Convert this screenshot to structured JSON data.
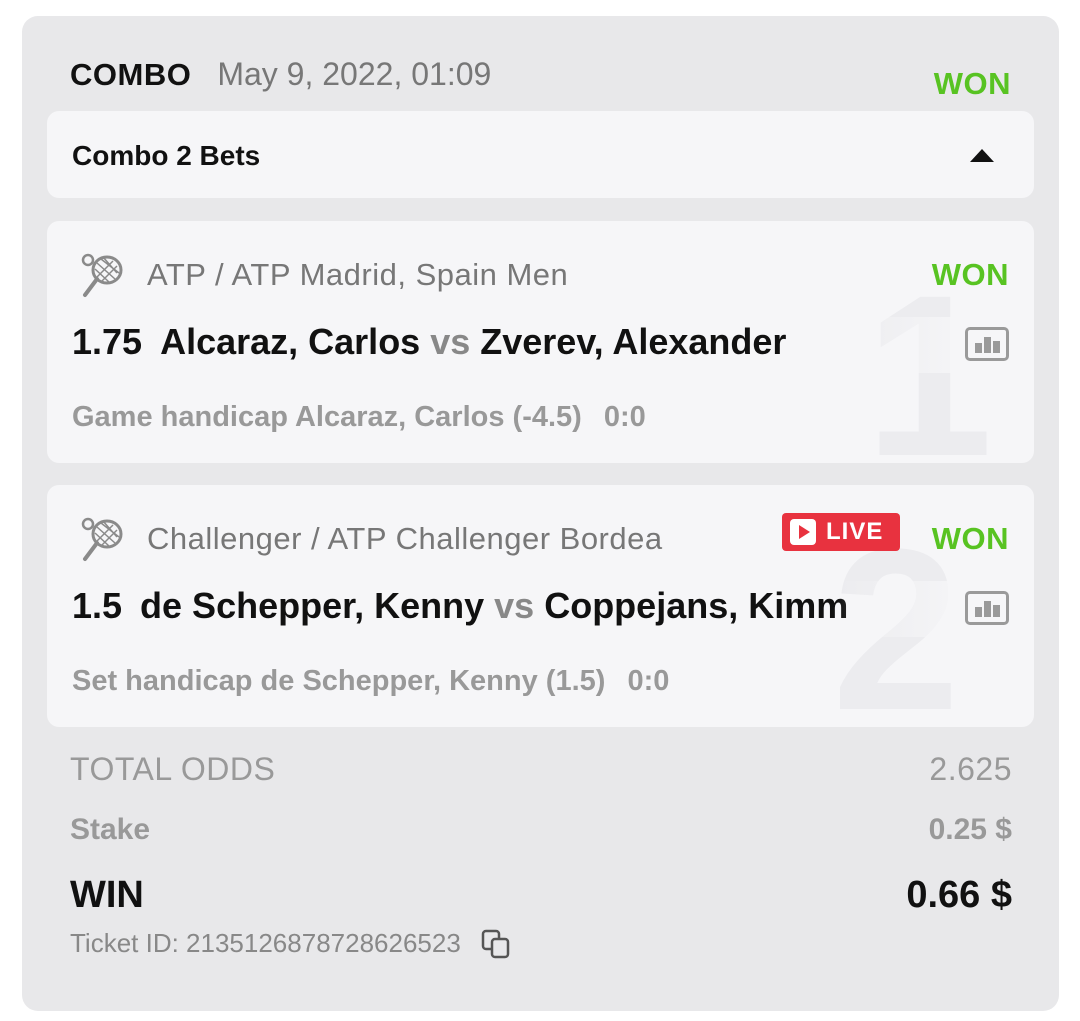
{
  "header": {
    "type_label": "COMBO",
    "date": "May 9, 2022, 01:09",
    "status": "WON"
  },
  "combo_bar": {
    "label": "Combo 2 Bets",
    "icon": "caret-up-icon"
  },
  "bets": [
    {
      "number": "1",
      "sport_icon": "tennis-racket-icon",
      "league": "ATP / ATP Madrid, Spain Men",
      "live": false,
      "status": "WON",
      "odds": "1.75",
      "team1": "Alcaraz, Carlos",
      "vs": "vs",
      "team2": "Zverev, Alexander",
      "market": "Game handicap Alcaraz, Carlos (-4.5)",
      "score": "0:0"
    },
    {
      "number": "2",
      "sport_icon": "tennis-racket-icon",
      "league": "Challenger / ATP Challenger Bordea",
      "live": true,
      "live_label": "LIVE",
      "status": "WON",
      "odds": "1.5",
      "team1": "de Schepper, Kenny",
      "vs": "vs",
      "team2": "Coppejans, Kimm",
      "market": "Set handicap de Schepper, Kenny (1.5)",
      "score": "0:0"
    }
  ],
  "totals": {
    "odds_label": "TOTAL ODDS",
    "odds_value": "2.625",
    "stake_label": "Stake",
    "stake_value": "0.25 $",
    "win_label": "WIN",
    "win_value": "0.66 $"
  },
  "ticket": {
    "label": "Ticket ID: 2135126878728626523",
    "icon": "copy-icon"
  },
  "colors": {
    "won": "#58c322",
    "live": "#e8323f",
    "card_bg": "#e8e8ea",
    "panel_bg": "#f6f6f8"
  }
}
